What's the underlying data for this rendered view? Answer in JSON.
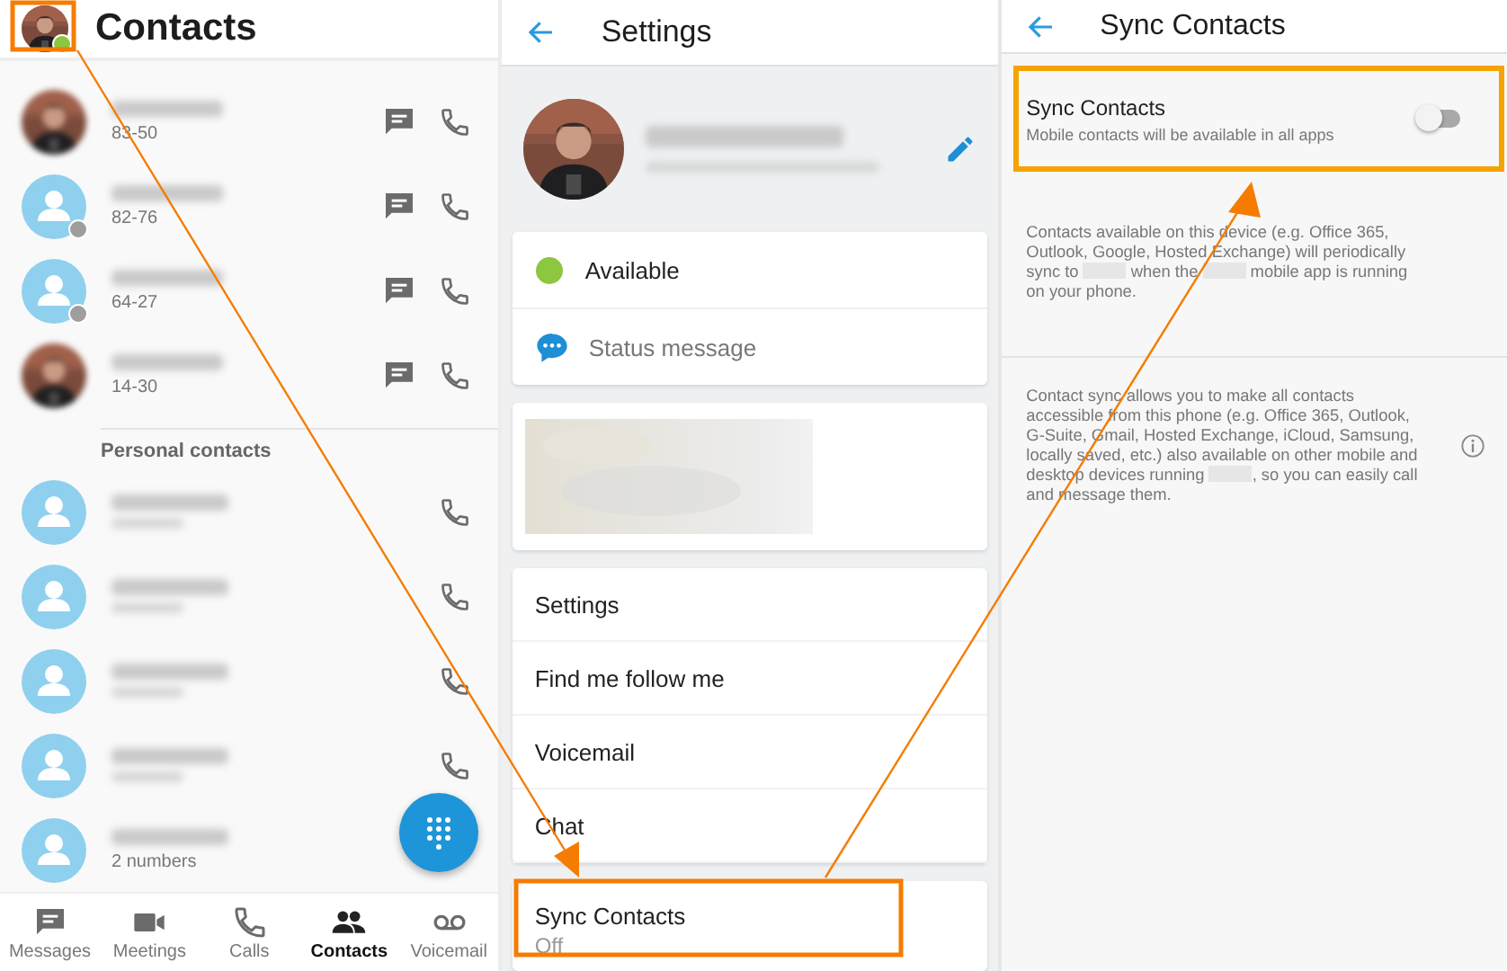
{
  "contacts_screen": {
    "title": "Contacts",
    "contacts": [
      {
        "number": "83-50"
      },
      {
        "kind": "person",
        "color": "#9e9e9e",
        "number": "82-76"
      },
      {
        "kind": "person",
        "color": "#9e9e9e",
        "number": "64-27"
      },
      {
        "number": "14-30"
      }
    ],
    "personal_heading": "Personal contacts",
    "personal_contacts": [
      {
        "kind": "person"
      },
      {
        "kind": "person"
      },
      {
        "kind": "person"
      },
      {
        "kind": "person"
      },
      {
        "kind": "person",
        "number": "2 numbers"
      }
    ],
    "nav": [
      {
        "label": "Messages",
        "selected": false
      },
      {
        "label": "Meetings",
        "selected": false
      },
      {
        "label": "Calls",
        "selected": false
      },
      {
        "label": "Contacts",
        "selected": true
      },
      {
        "label": "Voicemail",
        "selected": false
      }
    ]
  },
  "settings_screen": {
    "title": "Settings",
    "status": {
      "label": "Available",
      "color": "#8dc63f"
    },
    "status_message": {
      "placeholder": "Status message"
    },
    "menu": [
      "Settings",
      "Find me follow me",
      "Voicemail",
      "Chat"
    ],
    "sync": {
      "label": "Sync Contacts",
      "value": "Off"
    }
  },
  "sync_screen": {
    "title": "Sync Contacts",
    "toggle": {
      "label": "Sync Contacts",
      "description": "Mobile contacts will be available in all apps",
      "on": false
    },
    "paragraphs": [
      [
        {
          "kind": "text",
          "text": "Contacts available on this device (e.g. Office 365, Outlook, Google, Hosted Exchange) will periodically sync to"
        },
        {
          "kind": "redacted"
        },
        {
          "kind": "text",
          "text": "when the"
        },
        {
          "kind": "redacted"
        },
        {
          "kind": "text",
          "text": "mobile app is running on your phone."
        }
      ],
      [
        {
          "kind": "text",
          "text": "Contact sync allows you to make all contacts accessible from this phone (e.g. Office 365, Outlook, G-Suite, Gmail, Hosted Exchange, iCloud, Samsung, locally saved, etc.) also available on other mobile and desktop devices running"
        },
        {
          "kind": "redacted"
        },
        {
          "kind": "text",
          "text": ", so you can easily call and message them."
        }
      ]
    ]
  }
}
